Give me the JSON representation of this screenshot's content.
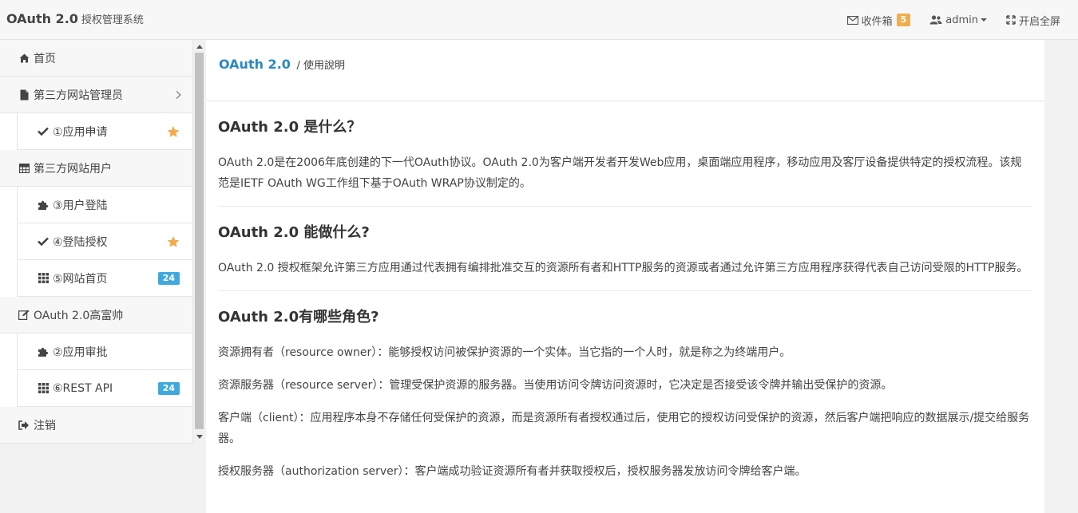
{
  "header": {
    "brand": "OAuth 2.0",
    "brand_sub": "授权管理系统",
    "inbox_label": "收件箱",
    "inbox_count": "5",
    "user_label": "admin",
    "fullscreen_label": "开启全屏"
  },
  "sidebar": {
    "items": [
      {
        "label": "首页",
        "icon": "home-icon"
      },
      {
        "label": "第三方网站管理员",
        "icon": "file-icon"
      },
      {
        "label": "①应用申请",
        "icon": "check-icon",
        "star": true
      },
      {
        "label": "第三方网站用户",
        "icon": "table-icon"
      },
      {
        "label": "③用户登陆",
        "icon": "puzzle-icon"
      },
      {
        "label": "④登陆授权",
        "icon": "check-icon",
        "star": true
      },
      {
        "label": "⑤网站首页",
        "icon": "grid-icon",
        "badge": "24"
      },
      {
        "label": "OAuth 2.0高富帅",
        "icon": "edit-icon"
      },
      {
        "label": "②应用审批",
        "icon": "puzzle-icon"
      },
      {
        "label": "⑥REST API",
        "icon": "grid-icon",
        "badge": "24"
      },
      {
        "label": "注销",
        "icon": "signout-icon"
      }
    ]
  },
  "page": {
    "title": "OAuth 2.0",
    "crumb": "/ 使用說明"
  },
  "sections": [
    {
      "heading": "OAuth 2.0 是什么？",
      "paragraphs": [
        "OAuth 2.0是在2006年底创建的下一代OAuth协议。OAuth 2.0为客户端开发者开发Web应用，桌面端应用程序，移动应用及客厅设备提供特定的授权流程。该规范是IETF OAuth WG工作组下基于OAuth WRAP协议制定的。"
      ]
    },
    {
      "heading": "OAuth 2.0 能做什么?",
      "paragraphs": [
        "OAuth 2.0 授权框架允许第三方应用通过代表拥有编排批准交互的资源所有者和HTTP服务的资源或者通过允许第三方应用程序获得代表自己访问受限的HTTP服务。"
      ]
    },
    {
      "heading": "OAuth 2.0有哪些角色?",
      "paragraphs": [
        "资源拥有者（resource owner）：能够授权访问被保护资源的一个实体。当它指的一个人时，就是称之为终端用户。",
        "资源服务器（resource server）：管理受保护资源的服务器。当使用访问令牌访问资源时，它决定是否接受该令牌并输出受保护的资源。",
        "客户端（client）：应用程序本身不存储任何受保护的资源，而是资源所有者授权通过后，使用它的授权访问受保护的资源，然后客户端把响应的数据展示/提交给服务器。",
        "授权服务器（authorization server）：客户端成功验证资源所有者并获取授权后，授权服务器发放访问令牌给客户端。"
      ]
    }
  ],
  "colors": {
    "accent": "#2a88c4",
    "badge_orange": "#f0ad4e",
    "badge_blue": "#3fa9de",
    "star": "#f0ad4e"
  }
}
